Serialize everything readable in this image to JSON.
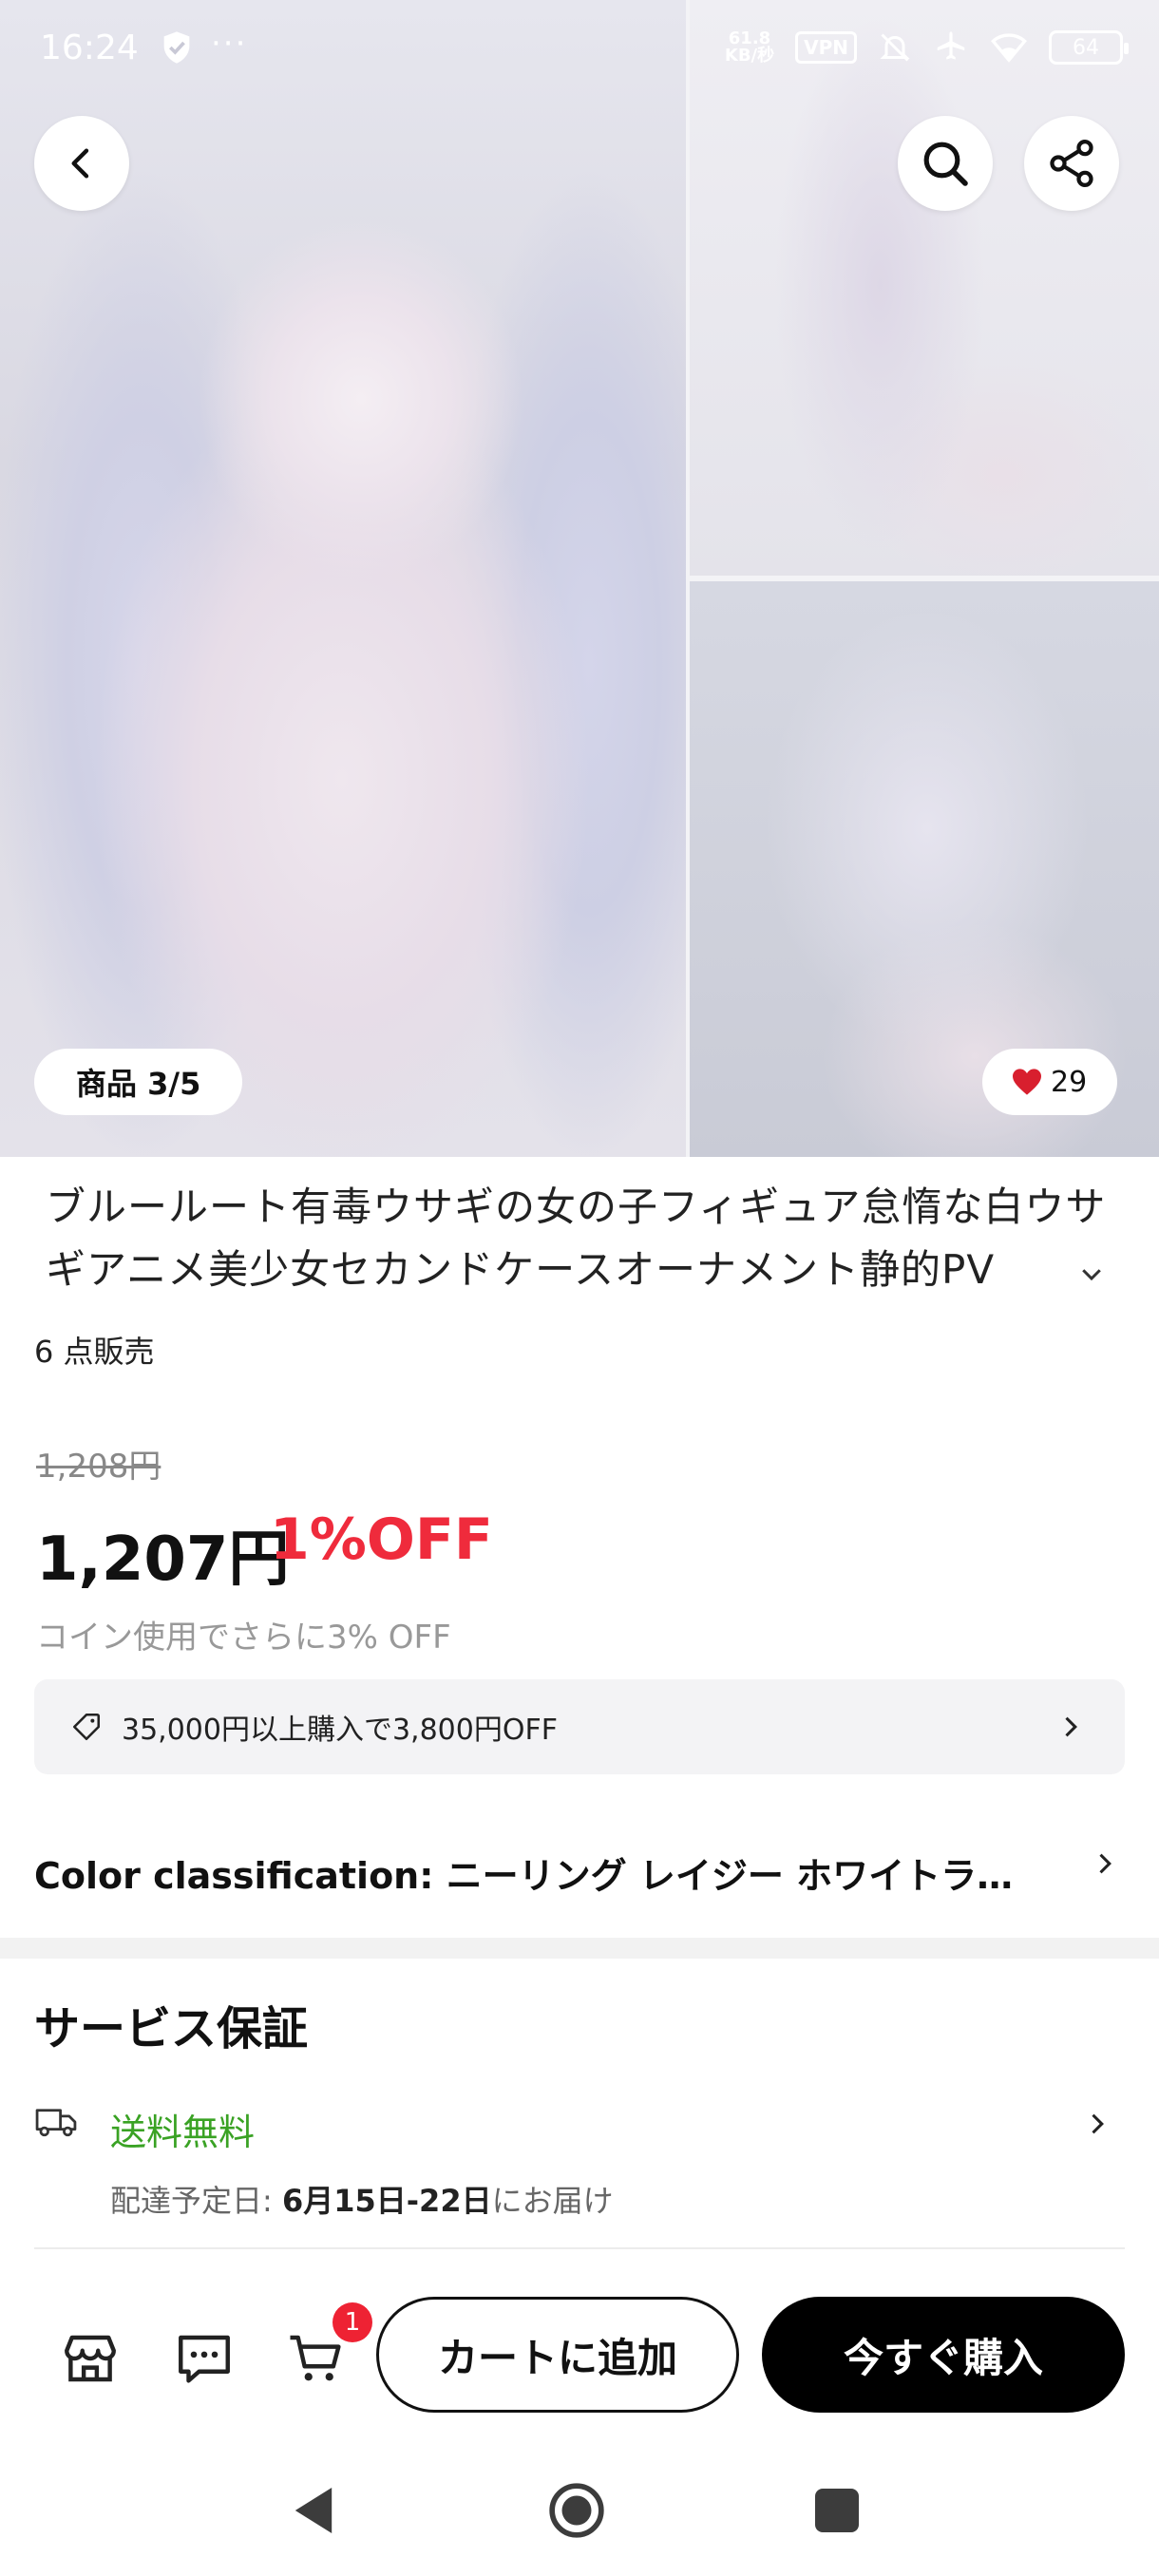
{
  "status_bar": {
    "time": "16:24",
    "extra_dots": "···",
    "speed_value": "61.8",
    "speed_unit": "KB/秒",
    "vpn": "VPN",
    "battery": "64"
  },
  "hero": {
    "pager_label": "商品 3/5",
    "favorites_count": "29"
  },
  "product": {
    "title": "ブルールート有毒ウサギの女の子フィギュア怠惰な白ウサギアニメ美少女セカンドケースオーナメント静的PV",
    "sold": "6 点販売",
    "original_price": "1,208円",
    "price": "1,207円",
    "discount": "1%OFF",
    "coin_note": "コイン使用でさらに3% OFF",
    "coupon": "35,000円以上購入で3,800円OFF",
    "variant": "Color classification: ニーリング レイジー ホワイトラビット"
  },
  "service": {
    "title": "サービス保証",
    "free_shipping": "送料無料",
    "delivery_prefix": "配達予定日: ",
    "delivery_dates": "6月15日-22日",
    "delivery_suffix": "にお届け"
  },
  "actions": {
    "cart_badge": "1",
    "add_to_cart": "カートに追加",
    "buy_now": "今すぐ購入"
  },
  "colors": {
    "discount_red": "#ef2b3c",
    "free_shipping_green": "#3aa224",
    "buy_button": "#000000",
    "badge_red": "#ee2233"
  }
}
